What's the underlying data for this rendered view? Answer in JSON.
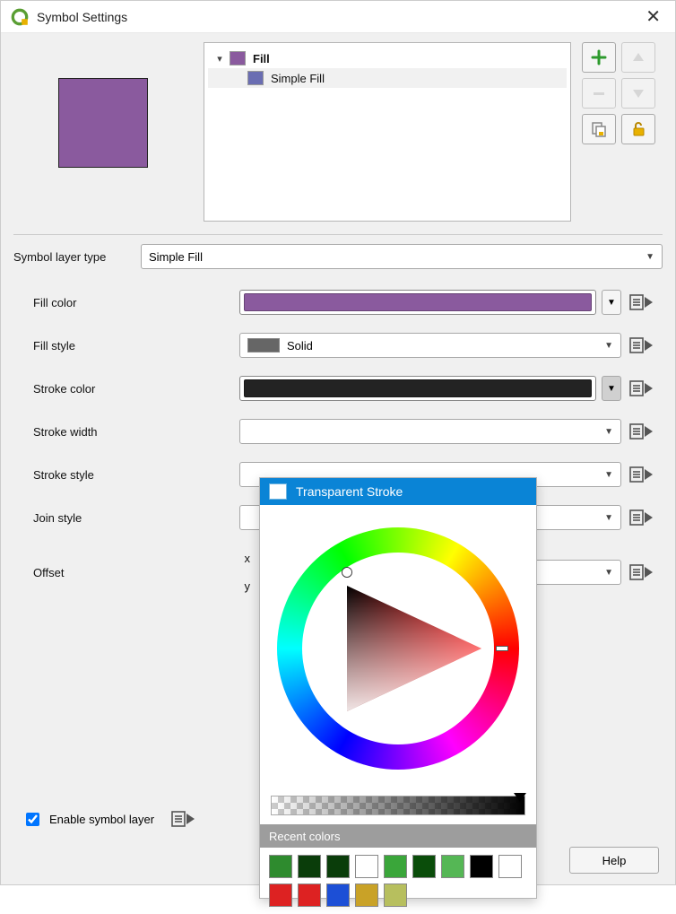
{
  "window": {
    "title": "Symbol Settings"
  },
  "preview_swatch_color": "#8a5a9e",
  "tree": {
    "root": {
      "label": "Fill",
      "color": "#8a5a9e"
    },
    "child": {
      "label": "Simple Fill",
      "color": "#6a6db2"
    }
  },
  "symbol_layer_type": {
    "label": "Symbol layer type",
    "value": "Simple Fill"
  },
  "props": {
    "fill_color": {
      "label": "Fill color",
      "value": "#8a5a9e"
    },
    "fill_style": {
      "label": "Fill style",
      "value": "Solid"
    },
    "stroke_color": {
      "label": "Stroke color",
      "value": "#232323"
    },
    "stroke_width": {
      "label": "Stroke width"
    },
    "stroke_style": {
      "label": "Stroke style"
    },
    "join_style": {
      "label": "Join style"
    },
    "offset": {
      "label": "Offset",
      "x_label": "x",
      "y_label": "y"
    }
  },
  "enable_symbol_layer": {
    "label": "Enable symbol layer",
    "checked": true
  },
  "buttons": {
    "help": "Help"
  },
  "color_popup": {
    "header": "Transparent Stroke",
    "recent_header": "Recent colors",
    "recent": [
      "#2e8b2e",
      "#0a3d0a",
      "#0a3d0a",
      "#ffffff",
      "#3aa63a",
      "#0a4d0a",
      "#55b755",
      "#000000",
      "#ffffff",
      "#d22",
      "#d22",
      "#1c4fd6",
      "#c9a227",
      "#b7bf5e"
    ]
  }
}
